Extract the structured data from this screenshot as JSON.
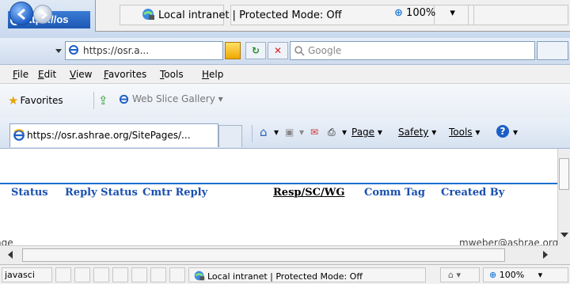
{
  "window": {
    "mini_title": "https://os"
  },
  "popup": {
    "zone_text": "Local intranet | Protected Mode: Off",
    "zoom": "100%"
  },
  "nav": {
    "address": "https://osr.a...",
    "search_placeholder": "Google"
  },
  "menu": [
    "File",
    "Edit",
    "View",
    "Favorites",
    "Tools",
    "Help"
  ],
  "favorites": {
    "label": "Favorites",
    "web_slice": "Web Slice Gallery"
  },
  "tab": {
    "title": "https://osr.ashrae.org/SitePages/..."
  },
  "commands": {
    "page": "Page",
    "safety": "Safety",
    "tools": "Tools"
  },
  "table": {
    "headers": [
      "Status",
      "Reply Status",
      "Cmtr Reply",
      "Resp/SC/WG",
      "Comm Tag",
      "Created By"
    ],
    "row_fragment_left": "nge",
    "row_fragment_email": "mweber@ashrae.org"
  },
  "status": {
    "left_text": "javasci",
    "zone_text": "Local intranet | Protected Mode: Off",
    "zoom": "100%"
  },
  "colors": {
    "header_blue": "#1a4faf",
    "accent_line": "#1b6fd0"
  }
}
